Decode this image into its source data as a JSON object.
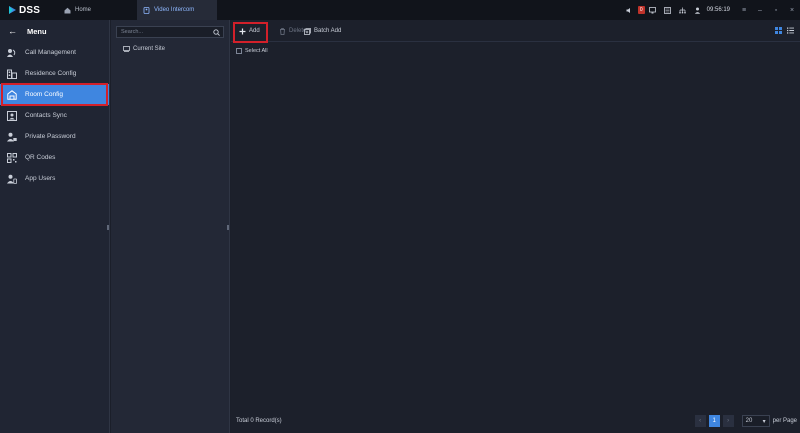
{
  "app": {
    "logo_text": "DSS"
  },
  "tabs": [
    {
      "label": "Home",
      "icon": "home-icon"
    },
    {
      "label": "Video Intercom",
      "icon": "intercom-icon"
    }
  ],
  "tray": {
    "alarm_count": "0",
    "clock": "09:56:19"
  },
  "menu": {
    "title": "Menu",
    "items": [
      {
        "label": "Call Management",
        "icon": "call-management-icon"
      },
      {
        "label": "Residence Config",
        "icon": "residence-icon"
      },
      {
        "label": "Room Config",
        "icon": "room-icon",
        "active": true
      },
      {
        "label": "Contacts Sync",
        "icon": "contacts-icon"
      },
      {
        "label": "Private Password",
        "icon": "password-icon"
      },
      {
        "label": "QR Codes",
        "icon": "qr-code-icon"
      },
      {
        "label": "App Users",
        "icon": "app-users-icon"
      }
    ]
  },
  "tree": {
    "search_placeholder": "Search...",
    "site": "Current Site"
  },
  "toolbar": {
    "add": "Add",
    "delete": "Delete",
    "batch_add": "Batch Add"
  },
  "list": {
    "select_all": "Select All"
  },
  "footer": {
    "total": "Total 0 Record(s)",
    "page": "1",
    "page_size": "20",
    "per_page": "per Page"
  },
  "colors": {
    "accent": "#3f86e0",
    "highlight": "#d3202a",
    "alarm": "#c0332b"
  }
}
